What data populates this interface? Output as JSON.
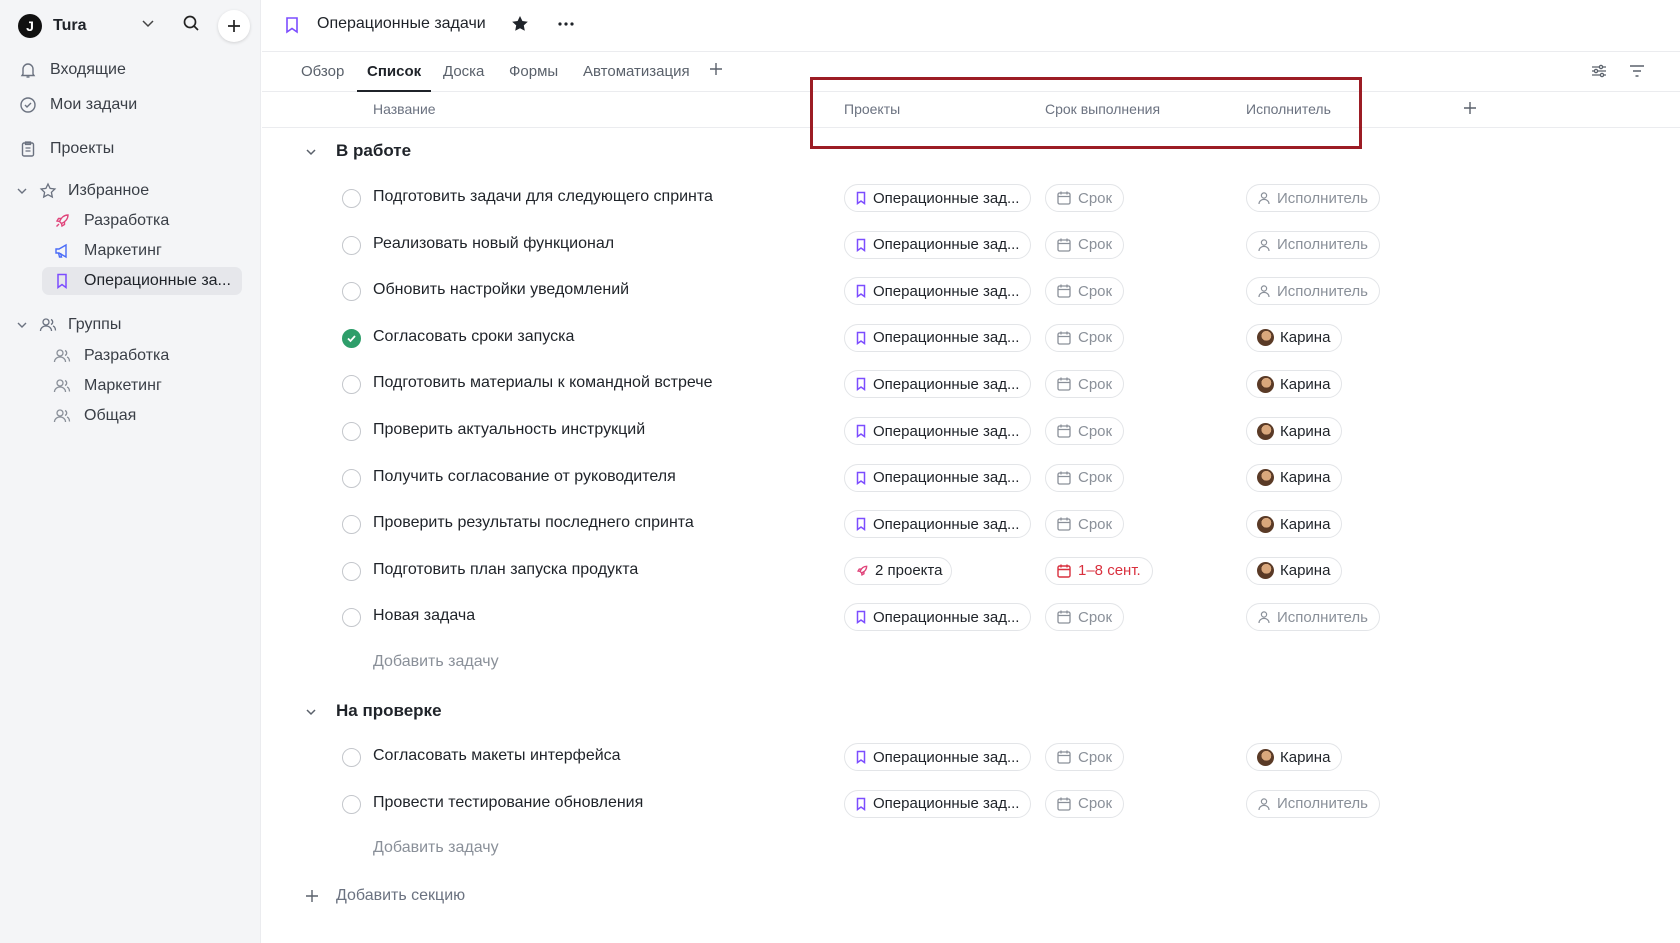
{
  "workspace": {
    "logo": "J",
    "name": "Tura"
  },
  "sidebar": {
    "inbox": "Входящие",
    "my_tasks": "Мои задачи",
    "projects": "Проекты",
    "favorites": {
      "label": "Избранное",
      "items": [
        {
          "label": "Разработка",
          "icon": "rocket-icon",
          "color": "#e0457b"
        },
        {
          "label": "Маркетинг",
          "icon": "megaphone-icon",
          "color": "#4a6cf7"
        },
        {
          "label": "Операционные за...",
          "icon": "bookmark-icon",
          "color": "#7c4dff",
          "active": true
        }
      ]
    },
    "groups": {
      "label": "Группы",
      "items": [
        {
          "label": "Разработка"
        },
        {
          "label": "Маркетинг"
        },
        {
          "label": "Общая"
        }
      ]
    }
  },
  "header": {
    "title": "Операционные задачи"
  },
  "tabs": [
    {
      "label": "Обзор"
    },
    {
      "label": "Список",
      "active": true
    },
    {
      "label": "Доска"
    },
    {
      "label": "Формы"
    },
    {
      "label": "Автоматизация"
    }
  ],
  "columns": {
    "name": "Название",
    "projects": "Проекты",
    "due": "Срок выполнения",
    "assignee": "Исполнитель"
  },
  "sections": [
    {
      "label": "В работе",
      "add_task": "Добавить задачу",
      "tasks": [
        {
          "name": "Подготовить задачи для следующего спринта",
          "done": false,
          "project": "Операционные зад...",
          "due": "Срок",
          "assignee": "Исполнитель",
          "assigned": false
        },
        {
          "name": "Реализовать новый функционал",
          "done": false,
          "project": "Операционные зад...",
          "due": "Срок",
          "assignee": "Исполнитель",
          "assigned": false
        },
        {
          "name": "Обновить настройки уведомлений",
          "done": false,
          "project": "Операционные зад...",
          "due": "Срок",
          "assignee": "Исполнитель",
          "assigned": false
        },
        {
          "name": "Согласовать сроки запуска",
          "done": true,
          "project": "Операционные зад...",
          "due": "Срок",
          "assignee": "Карина",
          "assigned": true
        },
        {
          "name": "Подготовить материалы к командной встрече",
          "done": false,
          "project": "Операционные зад...",
          "due": "Срок",
          "assignee": "Карина",
          "assigned": true
        },
        {
          "name": "Проверить актуальность инструкций",
          "done": false,
          "project": "Операционные зад...",
          "due": "Срок",
          "assignee": "Карина",
          "assigned": true
        },
        {
          "name": "Получить согласование от руководителя",
          "done": false,
          "project": "Операционные зад...",
          "due": "Срок",
          "assignee": "Карина",
          "assigned": true
        },
        {
          "name": "Проверить результаты последнего спринта",
          "done": false,
          "project": "Операционные зад...",
          "due": "Срок",
          "assignee": "Карина",
          "assigned": true
        },
        {
          "name": "Подготовить план запуска продукта",
          "done": false,
          "project": "2 проекта",
          "multi_project": true,
          "due": "1–8 сент.",
          "due_set": true,
          "assignee": "Карина",
          "assigned": true
        },
        {
          "name": "Новая задача",
          "done": false,
          "project": "Операционные зад...",
          "due": "Срок",
          "assignee": "Исполнитель",
          "assigned": false
        }
      ]
    },
    {
      "label": "На проверке",
      "add_task": "Добавить задачу",
      "tasks": [
        {
          "name": "Согласовать макеты интерфейса",
          "done": false,
          "project": "Операционные зад...",
          "due": "Срок",
          "assignee": "Карина",
          "assigned": true
        },
        {
          "name": "Провести тестирование обновления",
          "done": false,
          "project": "Операционные зад...",
          "due": "Срок",
          "assignee": "Исполнитель",
          "assigned": false
        }
      ]
    }
  ],
  "add_section": "Добавить секцию",
  "colors": {
    "accent_purple": "#7c4dff",
    "done_green": "#2e9e6a",
    "due_red": "#d9303e",
    "highlight": "#9c1c24"
  }
}
